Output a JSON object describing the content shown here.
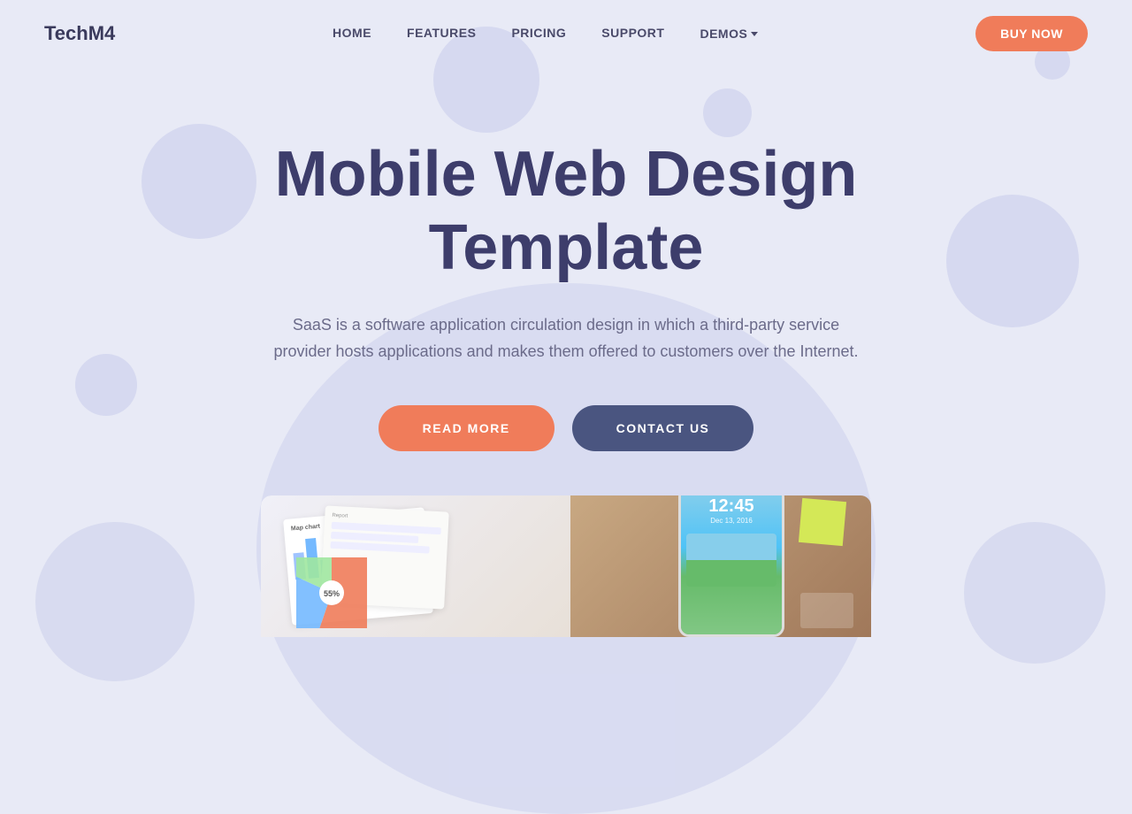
{
  "brand": {
    "logo": "TechM4"
  },
  "nav": {
    "links": [
      {
        "id": "home",
        "label": "HOME"
      },
      {
        "id": "features",
        "label": "FEATURES"
      },
      {
        "id": "pricing",
        "label": "PRICING"
      },
      {
        "id": "support",
        "label": "SUPPORT"
      },
      {
        "id": "demos",
        "label": "DEMOS"
      }
    ],
    "buy_now_label": "BUY NOW"
  },
  "hero": {
    "title_line1": "Mobile Web Design",
    "title_line2": "Template",
    "subtitle": "SaaS is a software application circulation design in which a third-party service provider hosts applications and makes them offered to customers over the Internet.",
    "btn_read_more": "READ MORE",
    "btn_contact_us": "CONTACT US"
  },
  "colors": {
    "bg": "#e8eaf6",
    "accent_orange": "#f07c5a",
    "accent_blue": "#4a5580",
    "text_dark": "#3d3d6b",
    "text_muted": "#6b6b8a",
    "logo_color": "#3a3a5c"
  },
  "mockup": {
    "phone_time": "12:45",
    "chart_label": "Map chart",
    "chart_percent": "55%"
  }
}
